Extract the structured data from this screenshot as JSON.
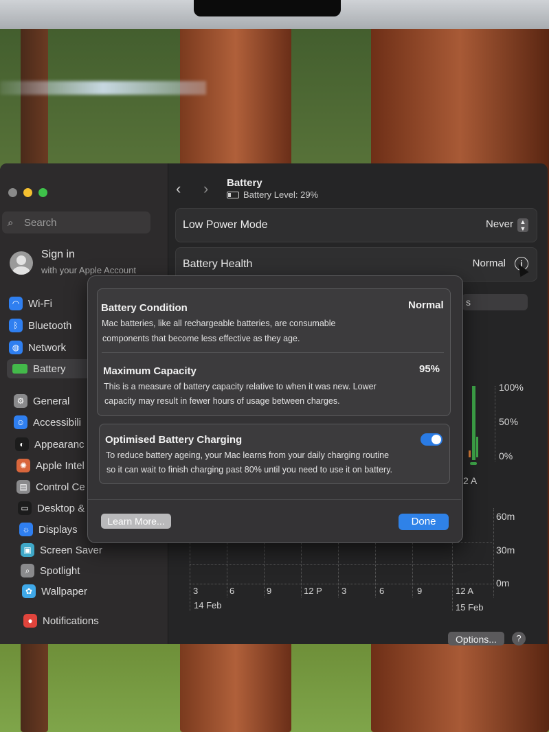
{
  "sidebar": {
    "search_placeholder": "Search",
    "signin_title": "Sign in",
    "signin_sub": "with your Apple Account",
    "items": [
      {
        "label": "Wi-Fi",
        "icon": "wifi-icon",
        "color": "#2f7ff0"
      },
      {
        "label": "Bluetooth",
        "icon": "bluetooth-icon",
        "color": "#2f7ff0"
      },
      {
        "label": "Network",
        "icon": "globe-icon",
        "color": "#2f7ff0"
      },
      {
        "label": "Battery",
        "icon": "battery-icon",
        "color": "#43b94a"
      },
      {
        "label": "General",
        "icon": "gear-icon",
        "color": "#8a8a8c"
      },
      {
        "label": "Accessibili",
        "icon": "accessibility-icon",
        "color": "#2f7ff0"
      },
      {
        "label": "Appearanc",
        "icon": "appearance-icon",
        "color": "#1c1c1c"
      },
      {
        "label": "Apple Intel",
        "icon": "apple-intelligence-icon",
        "color": "#d9663c"
      },
      {
        "label": "Control Ce",
        "icon": "control-centre-icon",
        "color": "#8a8a8c"
      },
      {
        "label": "Desktop &",
        "icon": "desktop-icon",
        "color": "#1c1c1c"
      },
      {
        "label": "Displays",
        "icon": "displays-icon",
        "color": "#2f7ff0"
      },
      {
        "label": "Screen Saver",
        "icon": "screen-saver-icon",
        "color": "#3fa8c8"
      },
      {
        "label": "Spotlight",
        "icon": "spotlight-icon",
        "color": "#8a8a8c"
      },
      {
        "label": "Wallpaper",
        "icon": "wallpaper-icon",
        "color": "#3fa8e8"
      },
      {
        "label": "Notifications",
        "icon": "notifications-icon",
        "color": "#e0443c"
      }
    ]
  },
  "header": {
    "title": "Battery",
    "subtitle": "Battery Level: 29%"
  },
  "settings": {
    "low_power_label": "Low Power Mode",
    "low_power_value": "Never",
    "health_label": "Battery Health",
    "health_value": "Normal",
    "behind_tab_fragment": "s"
  },
  "chart_labels": {
    "level_ticks": [
      "100%",
      "50%",
      "0%"
    ],
    "level_time_fragment": "2 A",
    "usage_ticks": [
      "60m",
      "30m",
      "0m"
    ],
    "x_ticks": [
      "3",
      "6",
      "9",
      "12 P",
      "3",
      "6",
      "9",
      "12 A"
    ],
    "date_left": "14 Feb",
    "date_right": "15 Feb"
  },
  "footer": {
    "options_label": "Options...",
    "help_label": "?"
  },
  "modal": {
    "condition_title": "Battery Condition",
    "condition_value": "Normal",
    "condition_desc_1": "Mac batteries, like all rechargeable batteries, are consumable",
    "condition_desc_2": "components that become less effective as they age.",
    "capacity_title": "Maximum Capacity",
    "capacity_value": "95%",
    "capacity_desc_1": "This is a measure of battery capacity relative to when it was new. Lower",
    "capacity_desc_2": "capacity may result in fewer hours of usage between charges.",
    "optimised_title": "Optimised Battery Charging",
    "optimised_desc_1": "To reduce battery ageing, your Mac learns from your daily charging routine",
    "optimised_desc_2": "so it can wait to finish charging past 80% until you need to use it on battery.",
    "optimised_enabled": true,
    "learn_more_label": "Learn More...",
    "done_label": "Done"
  }
}
